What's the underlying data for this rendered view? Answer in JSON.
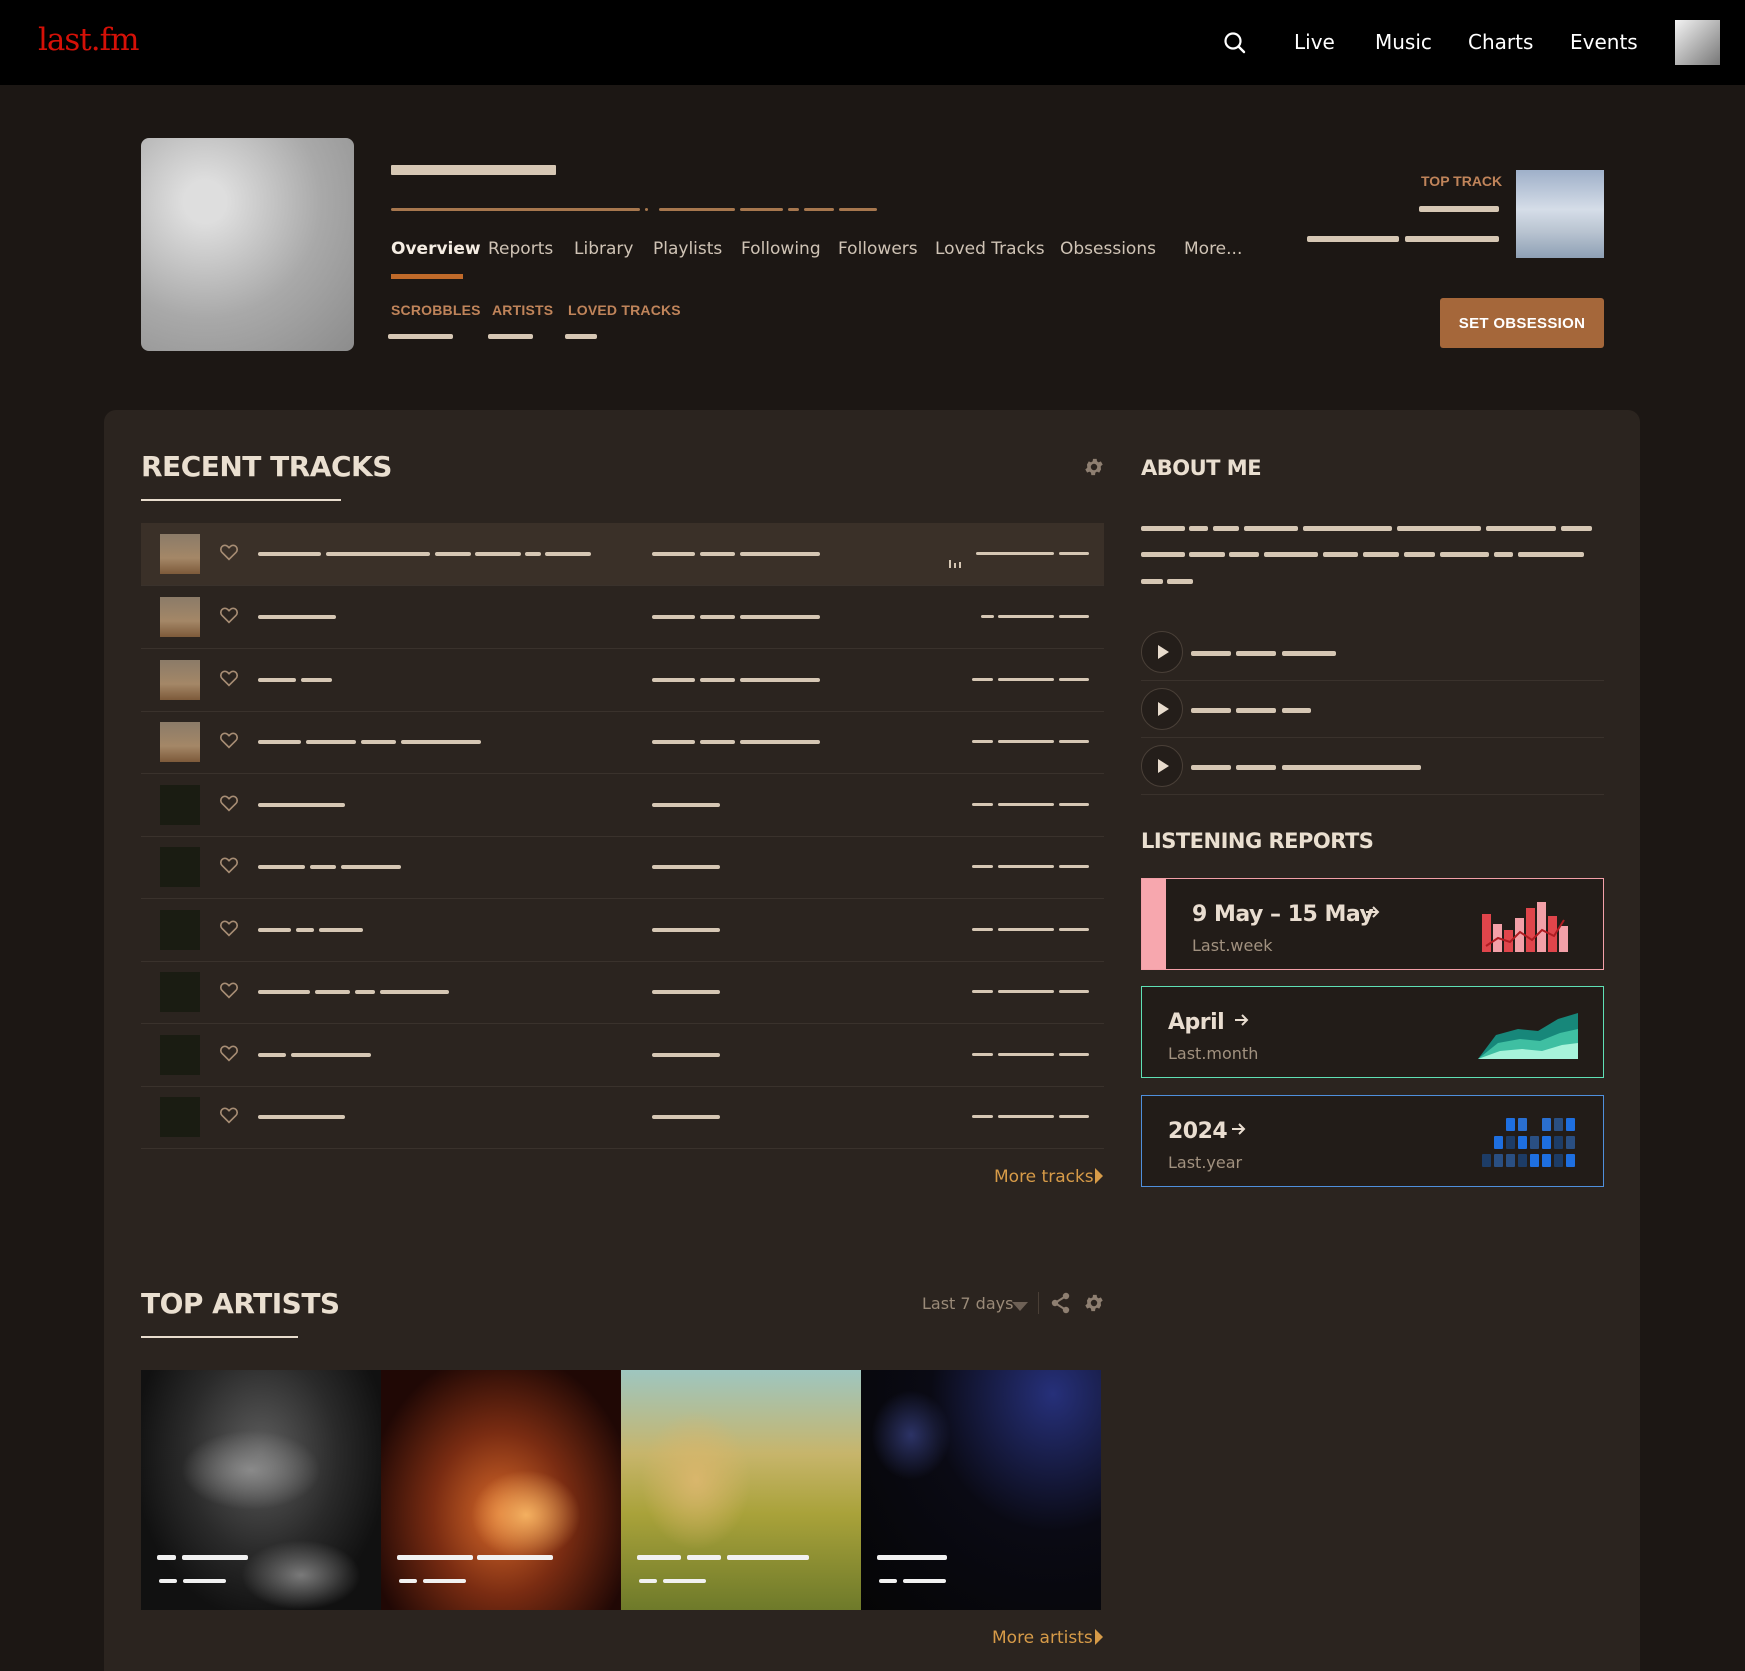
{
  "nav": {
    "logo": "last.fm",
    "links": [
      "Live",
      "Music",
      "Charts",
      "Events"
    ]
  },
  "profile": {
    "tabs": [
      "Overview",
      "Reports",
      "Library",
      "Playlists",
      "Following",
      "Followers",
      "Loved Tracks",
      "Obsessions",
      "More..."
    ],
    "active_tab": "Overview",
    "stats": [
      "SCROBBLES",
      "ARTISTS",
      "LOVED TRACKS"
    ],
    "top_track_label": "TOP TRACK",
    "set_obsession_label": "SET OBSESSION"
  },
  "recent_tracks": {
    "title": "RECENT TRACKS",
    "now_playing_row": 0,
    "more_label": "More tracks"
  },
  "about_me": {
    "title": "ABOUT ME"
  },
  "listening_reports": {
    "title": "LISTENING REPORTS",
    "items": [
      {
        "title": "9 May – 15 May",
        "sub": "Last.week",
        "accent": "#f3a0a8",
        "chart": "bars"
      },
      {
        "title": "April",
        "sub": "Last.month",
        "accent": "#5fe0b5",
        "chart": "area"
      },
      {
        "title": "2024",
        "sub": "Last.year",
        "accent": "#4f8fdc",
        "chart": "grid"
      }
    ]
  },
  "top_artists": {
    "title": "TOP ARTISTS",
    "period": "Last 7 days",
    "more_label": "More artists"
  },
  "colors": {
    "brand": "#d51007",
    "accent_button": "#a5673a",
    "link": "#d79b48",
    "tab_underline": "#c06a2a"
  },
  "icons": [
    "search-icon",
    "gear-icon",
    "heart-icon",
    "equalizer-icon",
    "play-icon",
    "arrow-right-icon",
    "chevron-down-icon",
    "share-icon",
    "caret-right-icon"
  ]
}
